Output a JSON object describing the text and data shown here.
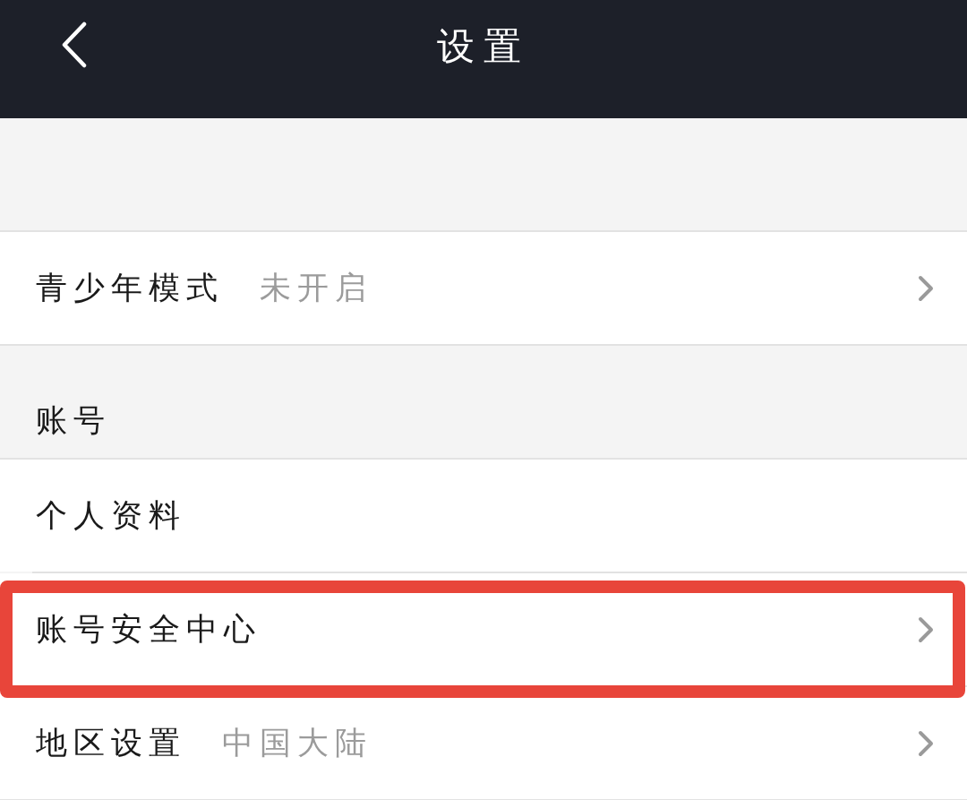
{
  "header": {
    "title": "设置"
  },
  "sections": [
    {
      "rows": [
        {
          "label": "青少年模式",
          "value": "未开启",
          "chevron": true,
          "highlighted": false
        }
      ]
    },
    {
      "title": "账号",
      "rows": [
        {
          "label": "个人资料",
          "chevron": false,
          "highlighted": false
        },
        {
          "label": "账号安全中心",
          "chevron": true,
          "highlighted": true
        },
        {
          "label": "地区设置",
          "value": "中国大陆",
          "chevron": true,
          "highlighted": false
        }
      ]
    }
  ]
}
